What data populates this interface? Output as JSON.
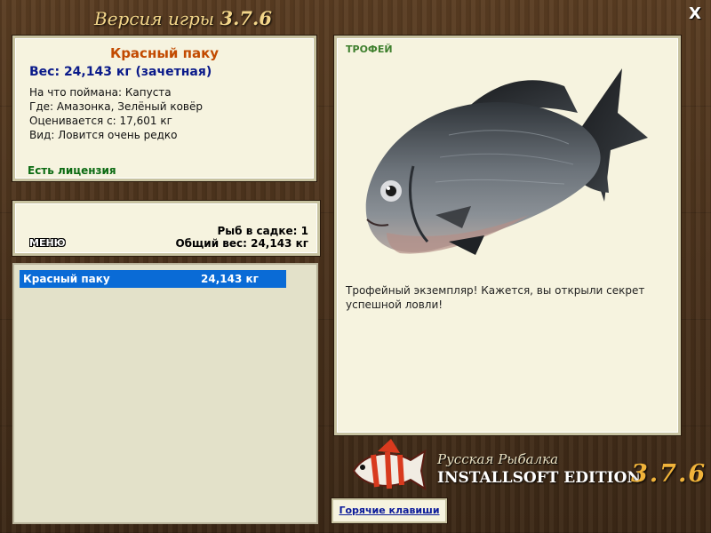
{
  "header": {
    "version_label": "Версия игры",
    "version_number": "3.7.6",
    "close_label": "X"
  },
  "info": {
    "fish_name": "Красный паку",
    "weight": "Вес: 24,143 кг (зачетная)",
    "bait": "На что поймана: Капуста",
    "location": "Где: Амазонка, Зелёный ковёр",
    "valued_from": "Оценивается с: 17,601 кг",
    "rarity": "Вид: Ловится очень редко",
    "license": "Есть лицензия"
  },
  "summary": {
    "menu_label": "МЕНЮ",
    "fish_count": "Рыб в садке: 1",
    "total_weight": "Общий вес: 24,143 кг"
  },
  "catch_list": [
    {
      "name": "Красный паку",
      "weight": "24,143 кг"
    }
  ],
  "detail": {
    "trophy_label": "ТРОФЕЙ",
    "description": "Трофейный экземпляр! Кажется, вы открыли секрет успешной ловли!"
  },
  "logo": {
    "script": "Русская Рыбалка",
    "edition": "INSTALLSOFT EDITION",
    "version": "3.7.6"
  },
  "footer": {
    "hotkeys_label": "Горячие клавиши"
  },
  "colors": {
    "fish_name": "#c24a00",
    "weight": "#0a1a8a",
    "license": "#0c6b13",
    "selected_row": "#0a6bd6",
    "trophy": "#3e7f2d"
  }
}
